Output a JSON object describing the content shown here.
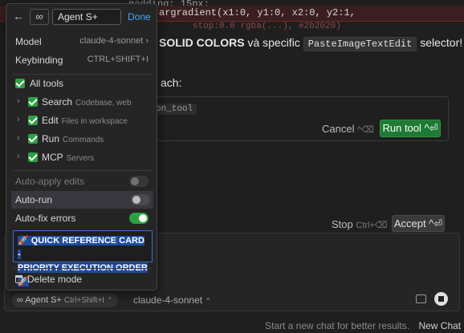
{
  "code": {
    "line1": "padding: 15px;",
    "line2": "argradient(x1:0, y1:0, x2:0, y2:1,",
    "line3": "stop:0.0 rgba(...), #2b2020)"
  },
  "chat": {
    "message_bold": "SOLID COLORS",
    "message_mid": " và specific ",
    "message_code": "PasteImageTextEdit",
    "message_tail": " selector!",
    "approach": "ach:",
    "tool_name": "on_tool",
    "cancel_label": "Cancel",
    "cancel_shortcut": "^⌫",
    "run_label": "Run tool ^⏎",
    "stop_label": "Stop",
    "stop_shortcut": "Ctrl+⌫",
    "accept_label": "Accept ^⏎"
  },
  "composer": {
    "agent_label": "∞ Agent S+",
    "agent_shortcut": "Ctrl+Shift+I",
    "model_label": "claude-4-sonnet"
  },
  "footer": {
    "hint": "Start a new chat for better results.",
    "new_chat": "New Chat"
  },
  "panel": {
    "infinity": "∞",
    "name_value": "Agent S+",
    "done": "Done",
    "model_label": "Model",
    "model_value": "claude-4-sonnet",
    "keybinding_label": "Keybinding",
    "keybinding_value": "CTRL+SHIFT+I",
    "all_tools": "All tools",
    "tools": [
      {
        "label": "Search",
        "sub": "Codebase, web"
      },
      {
        "label": "Edit",
        "sub": "Files in workspace"
      },
      {
        "label": "Run",
        "sub": "Commands"
      },
      {
        "label": "MCP",
        "sub": "Servers"
      }
    ],
    "auto_apply": "Auto-apply edits",
    "auto_run": "Auto-run",
    "auto_fix": "Auto-fix errors",
    "quick_ref_line1": "🚀 QUICK REFERENCE CARD -",
    "quick_ref_line2": "PRIORITY EXECUTION ORDER 🚀",
    "delete_mode": "Delete mode"
  },
  "colors": {
    "accent_green": "#2ea043",
    "link_blue": "#4aa3ff",
    "selection_blue": "#1d4ca0"
  }
}
